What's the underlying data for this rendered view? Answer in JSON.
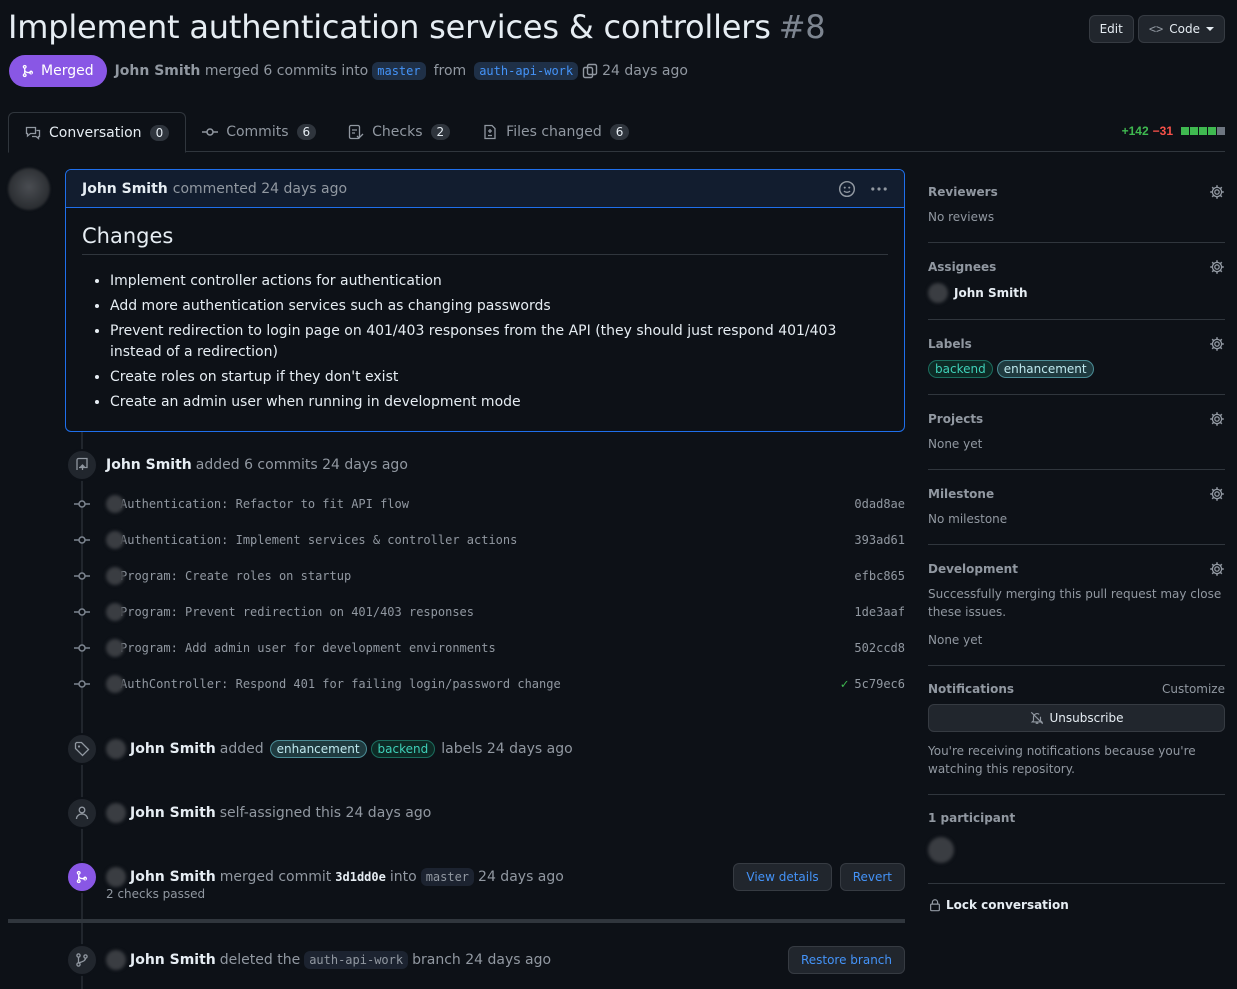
{
  "pr": {
    "title": "Implement authentication services & controllers",
    "number": "#8",
    "status": "Merged",
    "author": "John Smith",
    "merge_text": "merged 6 commits into",
    "base_branch": "master",
    "from_text": "from",
    "head_branch": "auth-api-work",
    "time": "24 days ago"
  },
  "header_buttons": {
    "edit": "Edit",
    "code": "Code"
  },
  "tabs": [
    {
      "label": "Conversation",
      "count": "0"
    },
    {
      "label": "Commits",
      "count": "6"
    },
    {
      "label": "Checks",
      "count": "2"
    },
    {
      "label": "Files changed",
      "count": "6"
    }
  ],
  "diffstat": {
    "additions": "+142",
    "deletions": "−31"
  },
  "comment": {
    "author": "John Smith",
    "action": "commented 24 days ago",
    "heading": "Changes",
    "items": [
      "Implement controller actions for authentication",
      "Add more authentication services such as changing passwords",
      "Prevent redirection to login page on 401/403 responses from the API (they should just respond 401/403 instead of a redirection)",
      "Create roles on startup if they don't exist",
      "Create an admin user when running in development mode"
    ]
  },
  "commits_event": {
    "author": "John Smith",
    "text": "added 6 commits 24 days ago"
  },
  "commits": [
    {
      "message": "Authentication: Refactor to fit API flow",
      "sha": "0dad8ae",
      "check": ""
    },
    {
      "message": "Authentication: Implement services & controller actions",
      "sha": "393ad61",
      "check": ""
    },
    {
      "message": "Program: Create roles on startup",
      "sha": "efbc865",
      "check": ""
    },
    {
      "message": "Program: Prevent redirection on 401/403 responses",
      "sha": "1de3aaf",
      "check": ""
    },
    {
      "message": "Program: Add admin user for development environments",
      "sha": "502ccd8",
      "check": ""
    },
    {
      "message": "AuthController: Respond 401 for failing login/password change",
      "sha": "5c79ec6",
      "check": "✓"
    }
  ],
  "labels_event": {
    "author": "John Smith",
    "added": "added",
    "label1": "enhancement",
    "label2": "backend",
    "suffix": "labels 24 days ago"
  },
  "assign_event": {
    "author": "John Smith",
    "text": "self-assigned this 24 days ago"
  },
  "merge_event": {
    "author": "John Smith",
    "text": "merged commit",
    "sha": "3d1dd0e",
    "into": "into",
    "branch": "master",
    "time": "24 days ago",
    "checks": "2 checks passed",
    "view_details": "View details",
    "revert": "Revert"
  },
  "delete_event": {
    "author": "John Smith",
    "text": "deleted the",
    "branch": "auth-api-work",
    "suffix": "branch 24 days ago",
    "restore": "Restore branch"
  },
  "sidebar": {
    "reviewers": {
      "title": "Reviewers",
      "value": "No reviews"
    },
    "assignees": {
      "title": "Assignees",
      "value": "John Smith"
    },
    "labels": {
      "title": "Labels",
      "items": [
        "backend",
        "enhancement"
      ]
    },
    "projects": {
      "title": "Projects",
      "value": "None yet"
    },
    "milestone": {
      "title": "Milestone",
      "value": "No milestone"
    },
    "development": {
      "title": "Development",
      "desc": "Successfully merging this pull request may close these issues.",
      "value": "None yet"
    },
    "notifications": {
      "title": "Notifications",
      "customize": "Customize",
      "button": "Unsubscribe",
      "desc": "You're receiving notifications because you're watching this repository."
    },
    "participants": {
      "title": "1 participant"
    },
    "lock": "Lock conversation"
  }
}
